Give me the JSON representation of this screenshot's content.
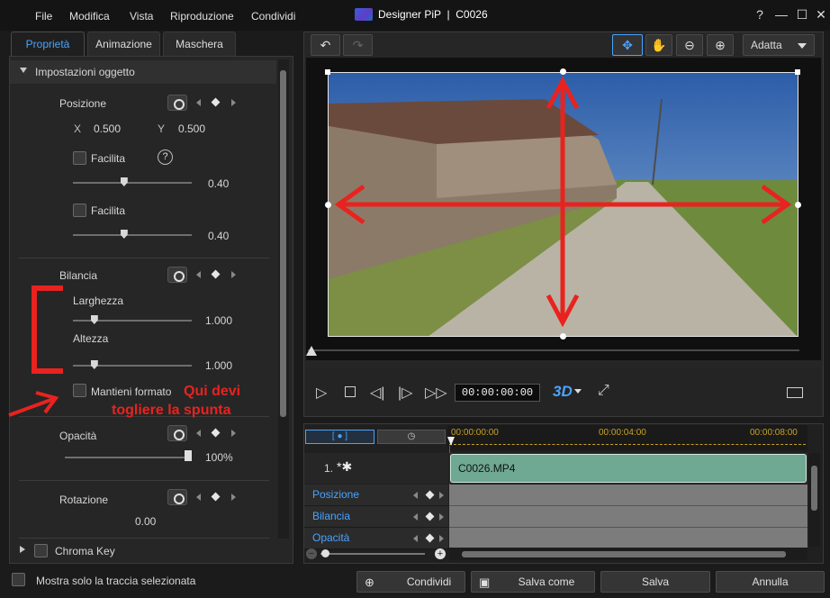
{
  "menu": [
    "File",
    "Modifica",
    "Vista",
    "Riproduzione",
    "Condividi"
  ],
  "window": {
    "title": "Designer PiP  |  C0026"
  },
  "window_controls": {
    "help": "?",
    "minimize": "—",
    "maximize": "☐",
    "close": "✕"
  },
  "tabs": [
    "Proprietà",
    "Animazione",
    "Maschera"
  ],
  "section": {
    "title": "Impostazioni oggetto"
  },
  "position": {
    "label": "Posizione",
    "x_label": "X",
    "x_value": "0.500",
    "y_label": "Y",
    "y_value": "0.500",
    "ease1_label": "Facilita",
    "ease1_value": "0.40",
    "ease2_label": "Facilita",
    "ease2_value": "0.40",
    "ease1_level": 0.4,
    "ease2_level": 0.4,
    "help_icon": "?"
  },
  "scale": {
    "label": "Bilancia",
    "width_label": "Larghezza",
    "width_value": "1.000",
    "width_level": 0.15,
    "height_label": "Altezza",
    "height_value": "1.000",
    "height_level": 0.15,
    "keep_ratio_label": "Mantieni formato"
  },
  "opacity": {
    "label": "Opacità",
    "value": "100%",
    "level": 1.0
  },
  "rotation": {
    "label": "Rotazione",
    "value": "0.00"
  },
  "chroma": {
    "label": "Chroma Key"
  },
  "annotation": {
    "line1": "Qui devi",
    "line2": "togliere la spunta"
  },
  "toolbar": {
    "zoom_label": "Adatta"
  },
  "preview": {
    "timecode": "00:00:00:00",
    "mode_label": "3D"
  },
  "timeline": {
    "ticks": [
      "00:00:00:00",
      "00:00:04:00",
      "00:00:08:00"
    ],
    "track_label": "1.",
    "clip_name": "C0026.MP4",
    "rows": [
      "Posizione",
      "Bilancia",
      "Opacità"
    ]
  },
  "bottom": {
    "show_selected_label": "Mostra solo la traccia selezionata",
    "share_label": "Condividi",
    "save_as_label": "Salva come",
    "save_label": "Salva",
    "cancel_label": "Annulla"
  },
  "colors": {
    "accent": "#4aa3ff",
    "annotation": "#e8231f",
    "clip": "#6fa893"
  },
  "icons": [
    "undo-icon",
    "redo-icon",
    "move-icon",
    "hand-icon",
    "zoom-out-icon",
    "zoom-in-icon",
    "play-icon",
    "stop-icon",
    "prev-frame-icon",
    "next-frame-icon",
    "fast-forward-icon",
    "fullscreen-icon",
    "keyframe-icon",
    "help-icon"
  ]
}
